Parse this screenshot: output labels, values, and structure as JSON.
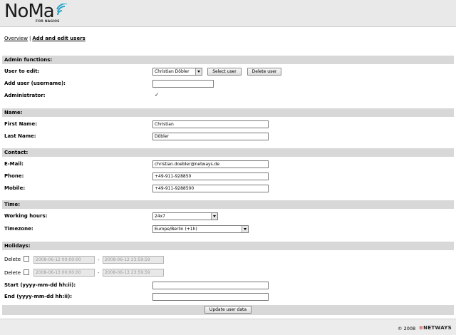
{
  "header": {
    "logo_text": "NoMa",
    "logo_sub": "FOR NAGIOS"
  },
  "breadcrumb": {
    "overview": "Overview",
    "separator": "|",
    "current": "Add and edit users"
  },
  "admin": {
    "heading": "Admin functions:",
    "user_to_edit_label": "User to edit:",
    "user_to_edit_value": "Christian Döbler",
    "select_user_button": "Select user",
    "delete_user_button": "Delete user",
    "add_user_label": "Add user (username):",
    "add_user_value": "",
    "administrator_label": "Administrator:",
    "administrator_checked": true,
    "check_glyph": "✓"
  },
  "name": {
    "heading": "Name:",
    "first_name_label": "First Name:",
    "first_name_value": "Christian",
    "last_name_label": "Last Name:",
    "last_name_value": "Döbler"
  },
  "contact": {
    "heading": "Contact:",
    "email_label": "E-Mail:",
    "email_value": "christian.doebler@netways.de",
    "phone_label": "Phone:",
    "phone_value": "+49-911-928850",
    "mobile_label": "Mobile:",
    "mobile_value": "+49-911-9288500"
  },
  "time": {
    "heading": "Time:",
    "working_hours_label": "Working hours:",
    "working_hours_value": "24x7",
    "timezone_label": "Timezone:",
    "timezone_value": "Europe/Berlin (+1h)"
  },
  "holidays": {
    "heading": "Holidays:",
    "rows": [
      {
        "delete_label": "Delete",
        "start": "2008-06-12 00:00:00",
        "dash": "-",
        "end": "2008-06-12 23:59:59"
      },
      {
        "delete_label": "Delete",
        "start": "2008-06-13 00:00:00",
        "dash": "-",
        "end": "2008-06-13 23:59:59"
      }
    ],
    "start_label": "Start (yyyy-mm-dd hh:ii):",
    "start_value": "",
    "end_label": "End (yyyy-mm-dd hh:ii):",
    "end_value": ""
  },
  "actions": {
    "update_button": "Update user data"
  },
  "footer": {
    "copyright": "© 2008",
    "brand_mark": "≡",
    "brand": "NETWAYS"
  }
}
